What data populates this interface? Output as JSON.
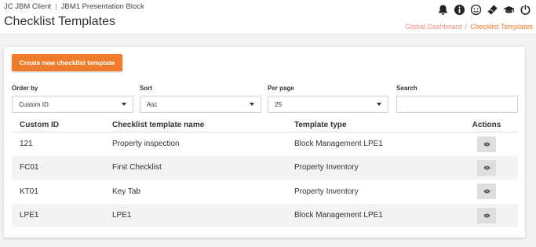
{
  "header": {
    "client": "JC JBM Client",
    "separator": "|",
    "block": "JBM1 Presentation Block",
    "title": "Checklist Templates",
    "icons": [
      "bell-icon",
      "info-icon",
      "smiley-icon",
      "ticket-icon",
      "graduation-cap-icon",
      "power-icon"
    ]
  },
  "breadcrumb": {
    "home": "Global Dashboard",
    "separator": "/",
    "current": "Checklist Templates"
  },
  "actions": {
    "create_label": "Create new checklist template"
  },
  "filters": {
    "order_by": {
      "label": "Order by",
      "value": "Custom ID"
    },
    "sort": {
      "label": "Sort",
      "value": "Asc"
    },
    "per_page": {
      "label": "Per page",
      "value": "25"
    },
    "search": {
      "label": "Search",
      "value": ""
    }
  },
  "table": {
    "headers": [
      "Custom ID",
      "Checklist template name",
      "Template type",
      "Actions"
    ],
    "rows": [
      {
        "id": "121",
        "name": "Property inspection",
        "type": "Block Management LPE1"
      },
      {
        "id": "FC01",
        "name": "First Checklist",
        "type": "Property Inventory"
      },
      {
        "id": "KT01",
        "name": "Key Tab",
        "type": "Property Inventory"
      },
      {
        "id": "LPE1",
        "name": "LPE1",
        "type": "Block Management LPE1"
      }
    ]
  },
  "colors": {
    "accent": "#f07b2a",
    "breadcrumb_link": "#f08a8a",
    "stripe": "#f3f3f3"
  }
}
